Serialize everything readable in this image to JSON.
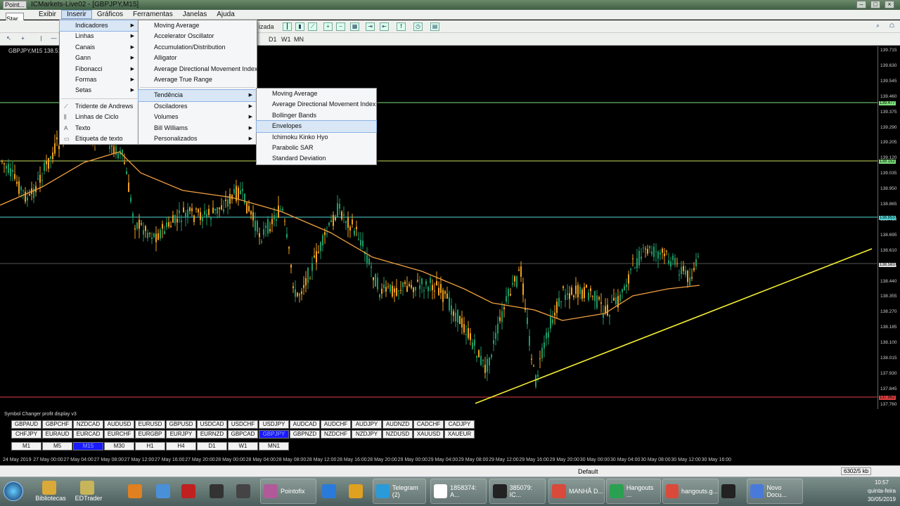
{
  "window": {
    "title": "ICMarkets-Live02 - [GBPJPY,M15]",
    "pointofix_tag": "Point...",
    "start_label": "Star..."
  },
  "menubar": {
    "items": [
      "Exibir",
      "Inserir",
      "Gráficos",
      "Ferramentas",
      "Janelas",
      "Ajuda"
    ],
    "active": "Inserir"
  },
  "toolbar": {
    "autotrade_partial": "izada",
    "timeframes": [
      "D1",
      "W1",
      "MN"
    ]
  },
  "chart": {
    "symbol_label": "GBPJPY,M15  138.512 13...",
    "background": "#000000",
    "candle_up": "#1e9a66",
    "candle_down": "#f0a020",
    "ma_color": "#f0a040",
    "trend_color": "#f5f032"
  },
  "insert_menu": {
    "items": [
      {
        "label": "Indicadores",
        "submenu": true
      },
      {
        "label": "Linhas",
        "submenu": true
      },
      {
        "label": "Canais",
        "submenu": true
      },
      {
        "label": "Gann",
        "submenu": true
      },
      {
        "label": "Fibonacci",
        "submenu": true
      },
      {
        "label": "Formas",
        "submenu": true
      },
      {
        "label": "Setas",
        "submenu": true
      },
      {
        "label": "Tridente de Andrews",
        "submenu": false
      },
      {
        "label": "Linhas de Ciclo",
        "submenu": false
      },
      {
        "label": "Texto",
        "submenu": false
      },
      {
        "label": "Etiqueta de texto",
        "submenu": false
      }
    ]
  },
  "indicators_menu": {
    "items": [
      "Moving Average",
      "Accelerator Oscillator",
      "Accumulation/Distribution",
      "Alligator",
      "Average Directional Movement Index",
      "Average True Range"
    ],
    "groups": [
      "Tendência",
      "Osciladores",
      "Volumes",
      "Bill Williams",
      "Personalizados"
    ],
    "active_group": "Tendência"
  },
  "trend_menu": {
    "items": [
      "Moving Average",
      "Average Directional Movement Index",
      "Bollinger Bands",
      "Envelopes",
      "Ichimoku Kinko Hyo",
      "Parabolic SAR",
      "Standard Deviation"
    ],
    "highlighted": "Envelopes"
  },
  "price_axis": [
    "139.715",
    "139.630",
    "139.545",
    "139.460",
    "139.375",
    "139.290",
    "139.205",
    "139.120",
    "139.035",
    "138.950",
    "138.865",
    "138.780",
    "138.695",
    "138.610",
    "138.525",
    "138.440",
    "138.355",
    "138.270",
    "138.185",
    "138.100",
    "138.015",
    "137.930",
    "137.845",
    "137.760"
  ],
  "price_tags": [
    {
      "value": "139.477",
      "color": "#7ee07e"
    },
    {
      "value": "139.152",
      "color": "#7ee07e"
    },
    {
      "value": "138.853",
      "color": "#4fd6d6"
    },
    {
      "value": "138.583",
      "color": "#dddddd"
    },
    {
      "value": "137.862",
      "color": "#e04040"
    }
  ],
  "symbol_changer": {
    "title": "Symbol Changer profit display v3",
    "row1": [
      "GBPAUD",
      "GBPCHF",
      "NZDCAD",
      "AUDUSD",
      "EURUSD",
      "GBPUSD",
      "USDCAD",
      "USDCHF",
      "USDJPY",
      "AUDCAD",
      "AUDCHF",
      "AUDJPY",
      "AUDNZD",
      "CADCHF",
      "CADJPY"
    ],
    "row2": [
      "CHFJPY",
      "EURAUD",
      "EURCAD",
      "EURCHF",
      "EURGBP",
      "EURJPY",
      "EURNZD",
      "GBPCAD",
      "GBPJPY",
      "GBPNZD",
      "NZDCHF",
      "NZDJPY",
      "NZDUSD",
      "XAUUSD",
      "XAUEUR"
    ],
    "row3": [
      "M1",
      "M5",
      "M15",
      "M30",
      "H1",
      "H4",
      "D1",
      "W1",
      "MN1"
    ],
    "selected_symbol": "GBPJPY",
    "selected_tf": "M15"
  },
  "time_axis": [
    "24 May 2019",
    "27 May 00:00",
    "27 May 04:00",
    "27 May 08:00",
    "27 May 12:00",
    "27 May 16:00",
    "27 May 20:00",
    "28 May 00:00",
    "28 May 04:00",
    "28 May 08:00",
    "28 May 12:00",
    "28 May 16:00",
    "28 May 20:00",
    "29 May 00:00",
    "29 May 04:00",
    "29 May 08:00",
    "29 May 12:00",
    "29 May 16:00",
    "29 May 20:00",
    "30 May 00:00",
    "30 May 04:00",
    "30 May 08:00",
    "30 May 12:00",
    "30 May 16:00"
  ],
  "statusbar": {
    "profile": "Default",
    "traffic": "6302/5 kb"
  },
  "taskbar": {
    "items": [
      {
        "label": "Bibliotecas",
        "color": "#d9a93a"
      },
      {
        "label": "EDTrader",
        "color": "#c8b55a"
      },
      {
        "label": "",
        "color": "#e08020"
      },
      {
        "label": "",
        "color": "#4a90d9"
      },
      {
        "label": "",
        "color": "#c02020"
      },
      {
        "label": "",
        "color": "#333333"
      },
      {
        "label": "",
        "color": "#444444"
      },
      {
        "label": "Pointofix",
        "color": "#b05a9a"
      },
      {
        "label": "",
        "color": "#2a7ad9"
      },
      {
        "label": "",
        "color": "#e0a020"
      },
      {
        "label": "Telegram (2)",
        "color": "#2a9ad9"
      },
      {
        "label": "1858374: A...",
        "color": "#ffffff"
      },
      {
        "label": "385079: IC...",
        "color": "#222222"
      },
      {
        "label": "MANHÃ D...",
        "color": "#d94a3a"
      },
      {
        "label": "Hangouts ...",
        "color": "#2aa050"
      },
      {
        "label": "hangouts.g...",
        "color": "#d94a3a"
      },
      {
        "label": "",
        "color": "#222222"
      },
      {
        "label": "Novo Docu...",
        "color": "#4a7ad9"
      }
    ],
    "time": "10:57",
    "day": "quinta-feira",
    "date": "30/05/2019"
  }
}
